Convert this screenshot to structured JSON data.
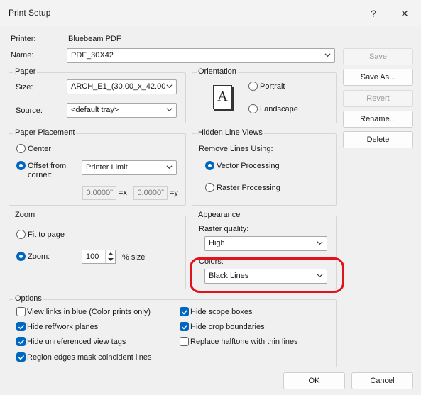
{
  "window": {
    "title": "Print Setup",
    "help": "?",
    "close": "✕"
  },
  "printer": {
    "label": "Printer:",
    "value": "Bluebeam PDF"
  },
  "name": {
    "label": "Name:",
    "value": "PDF_30X42"
  },
  "buttons": {
    "save": "Save",
    "save_as": "Save As...",
    "revert": "Revert",
    "rename": "Rename...",
    "delete": "Delete",
    "ok": "OK",
    "cancel": "Cancel"
  },
  "paper": {
    "title": "Paper",
    "size_label": "Size:",
    "size_value": "ARCH_E1_(30.00_x_42.00",
    "source_label": "Source:",
    "source_value": "<default tray>"
  },
  "orientation": {
    "title": "Orientation",
    "icon_letter": "A",
    "portrait": "Portrait",
    "landscape": "Landscape",
    "selected": "none"
  },
  "placement": {
    "title": "Paper Placement",
    "center": "Center",
    "offset_line1": "Offset from",
    "offset_line2": "corner:",
    "offset_value": "Printer Limit",
    "x_value": "0.0000\"",
    "x_suffix": "=x",
    "y_value": "0.0000\"",
    "y_suffix": "=y",
    "selected": "offset"
  },
  "hidden_lines": {
    "title": "Hidden Line Views",
    "remove_label": "Remove Lines Using:",
    "vector": "Vector Processing",
    "raster": "Raster Processing",
    "selected": "vector"
  },
  "zoom": {
    "title": "Zoom",
    "fit": "Fit to page",
    "zoom": "Zoom:",
    "zoom_value": "100",
    "size_suffix": "% size",
    "selected": "zoom"
  },
  "appearance": {
    "title": "Appearance",
    "raster_label": "Raster quality:",
    "raster_value": "High",
    "colors_label": "Colors:",
    "colors_value": "Black Lines"
  },
  "options": {
    "title": "Options",
    "left": [
      {
        "label": "View links in blue (Color prints only)",
        "checked": false
      },
      {
        "label": "Hide ref/work planes",
        "checked": true
      },
      {
        "label": "Hide unreferenced view tags",
        "checked": true
      },
      {
        "label": "Region edges mask coincident lines",
        "checked": true
      }
    ],
    "right": [
      {
        "label": "Hide scope boxes",
        "checked": true
      },
      {
        "label": "Hide crop boundaries",
        "checked": true
      },
      {
        "label": "Replace halftone with thin lines",
        "checked": false
      }
    ]
  },
  "colors": {
    "accent": "#0067c0",
    "annotation": "#e0121b"
  }
}
